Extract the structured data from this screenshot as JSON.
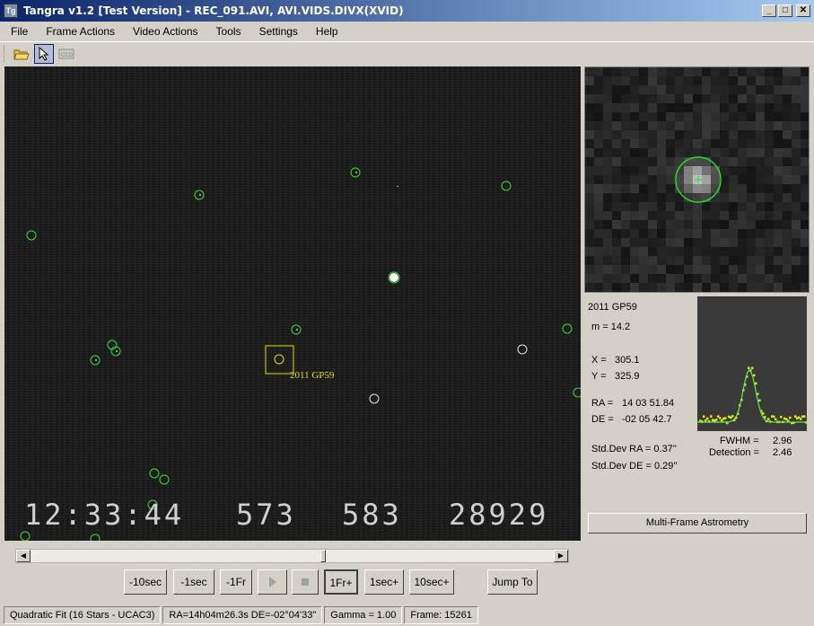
{
  "window": {
    "title": "Tangra v1.2 [Test Version] - REC_091.AVI, AVI.VIDS.DIVX(XVID)",
    "app_icon_label": "Tg",
    "controls": [
      "_",
      "□",
      "✕"
    ]
  },
  "menu": [
    "File",
    "Frame Actions",
    "Video Actions",
    "Tools",
    "Settings",
    "Help"
  ],
  "toolbar": {
    "buttons": [
      "open-folder-icon",
      "pointer-icon",
      "ccd-icon"
    ],
    "ccd_label": "CCD"
  },
  "video": {
    "timestamp_overlay": [
      "12:33:44",
      "573",
      "583",
      "28929"
    ],
    "target_label": "2011 GP59"
  },
  "target": {
    "name": "2011 GP59",
    "magnitude": "m = 14.2",
    "x_label": "X =",
    "x_value": "305.1",
    "y_label": "Y =",
    "y_value": "325.9",
    "ra_label": "RA =",
    "ra_value": "14 03 51.84",
    "de_label": "DE =",
    "de_value": "-02 05 42.7",
    "stddev_ra": "Std.Dev RA = 0.37''",
    "stddev_de": "Std.Dev DE = 0.29''",
    "fwhm_label": "FWHM =",
    "fwhm_value": "2.96",
    "detection_label": "Detection =",
    "detection_value": "2.46"
  },
  "buttons": {
    "multi_frame": "Multi-Frame Astrometry",
    "minus_10sec": "-10sec",
    "minus_1sec": "-1sec",
    "minus_1fr": "-1Fr",
    "plus_1fr": "1Fr+",
    "plus_1sec": "1sec+",
    "plus_10sec": "10sec+",
    "jump_to": "Jump To"
  },
  "status": {
    "fit": "Quadratic Fit (16 Stars - UCAC3)",
    "coords": "RA=14h04m26.3s DE=-02°04'33\"",
    "gamma": "Gamma = 1.00",
    "frame": "Frame: 15261"
  },
  "colors": {
    "title_start": "#0a246a",
    "title_end": "#a6caf0",
    "star_circle": "#33dd33",
    "target_box": "#e0e000",
    "overlay_text": "#c8c8c8"
  }
}
